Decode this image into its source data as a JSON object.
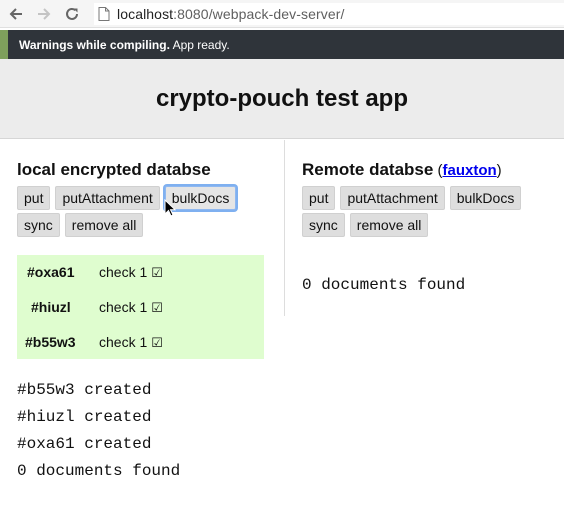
{
  "browser": {
    "url_host": "localhost",
    "url_rest": ":8080/webpack-dev-server/",
    "icons": [
      "back-arrow-icon",
      "forward-arrow-icon",
      "reload-icon",
      "page-icon"
    ]
  },
  "banner": {
    "strong": "Warnings while compiling.",
    "rest": " App ready.",
    "accent_color": "#7e9f5c",
    "bg_color": "#2f343a"
  },
  "app": {
    "title": "crypto-pouch test app"
  },
  "local": {
    "title": "local encrypted databse",
    "buttons": [
      "put",
      "putAttachment",
      "bulkDocs",
      "sync",
      "remove all"
    ],
    "focused_button": "bulkDocs",
    "docs": [
      {
        "id": "#oxa61",
        "check": "check 1"
      },
      {
        "id": "#hiuzl",
        "check": "check 1"
      },
      {
        "id": "#b55w3",
        "check": "check 1"
      }
    ],
    "docs_bg": "#dffdcf",
    "log": [
      "#b55w3 created",
      "#hiuzl created",
      "#oxa61 created",
      "0 documents found"
    ]
  },
  "remote": {
    "title": "Remote databse",
    "paren_open": " (",
    "link": "fauxton",
    "paren_close": ")",
    "buttons": [
      "put",
      "putAttachment",
      "bulkDocs",
      "sync",
      "remove all"
    ],
    "status": "0 documents found"
  }
}
